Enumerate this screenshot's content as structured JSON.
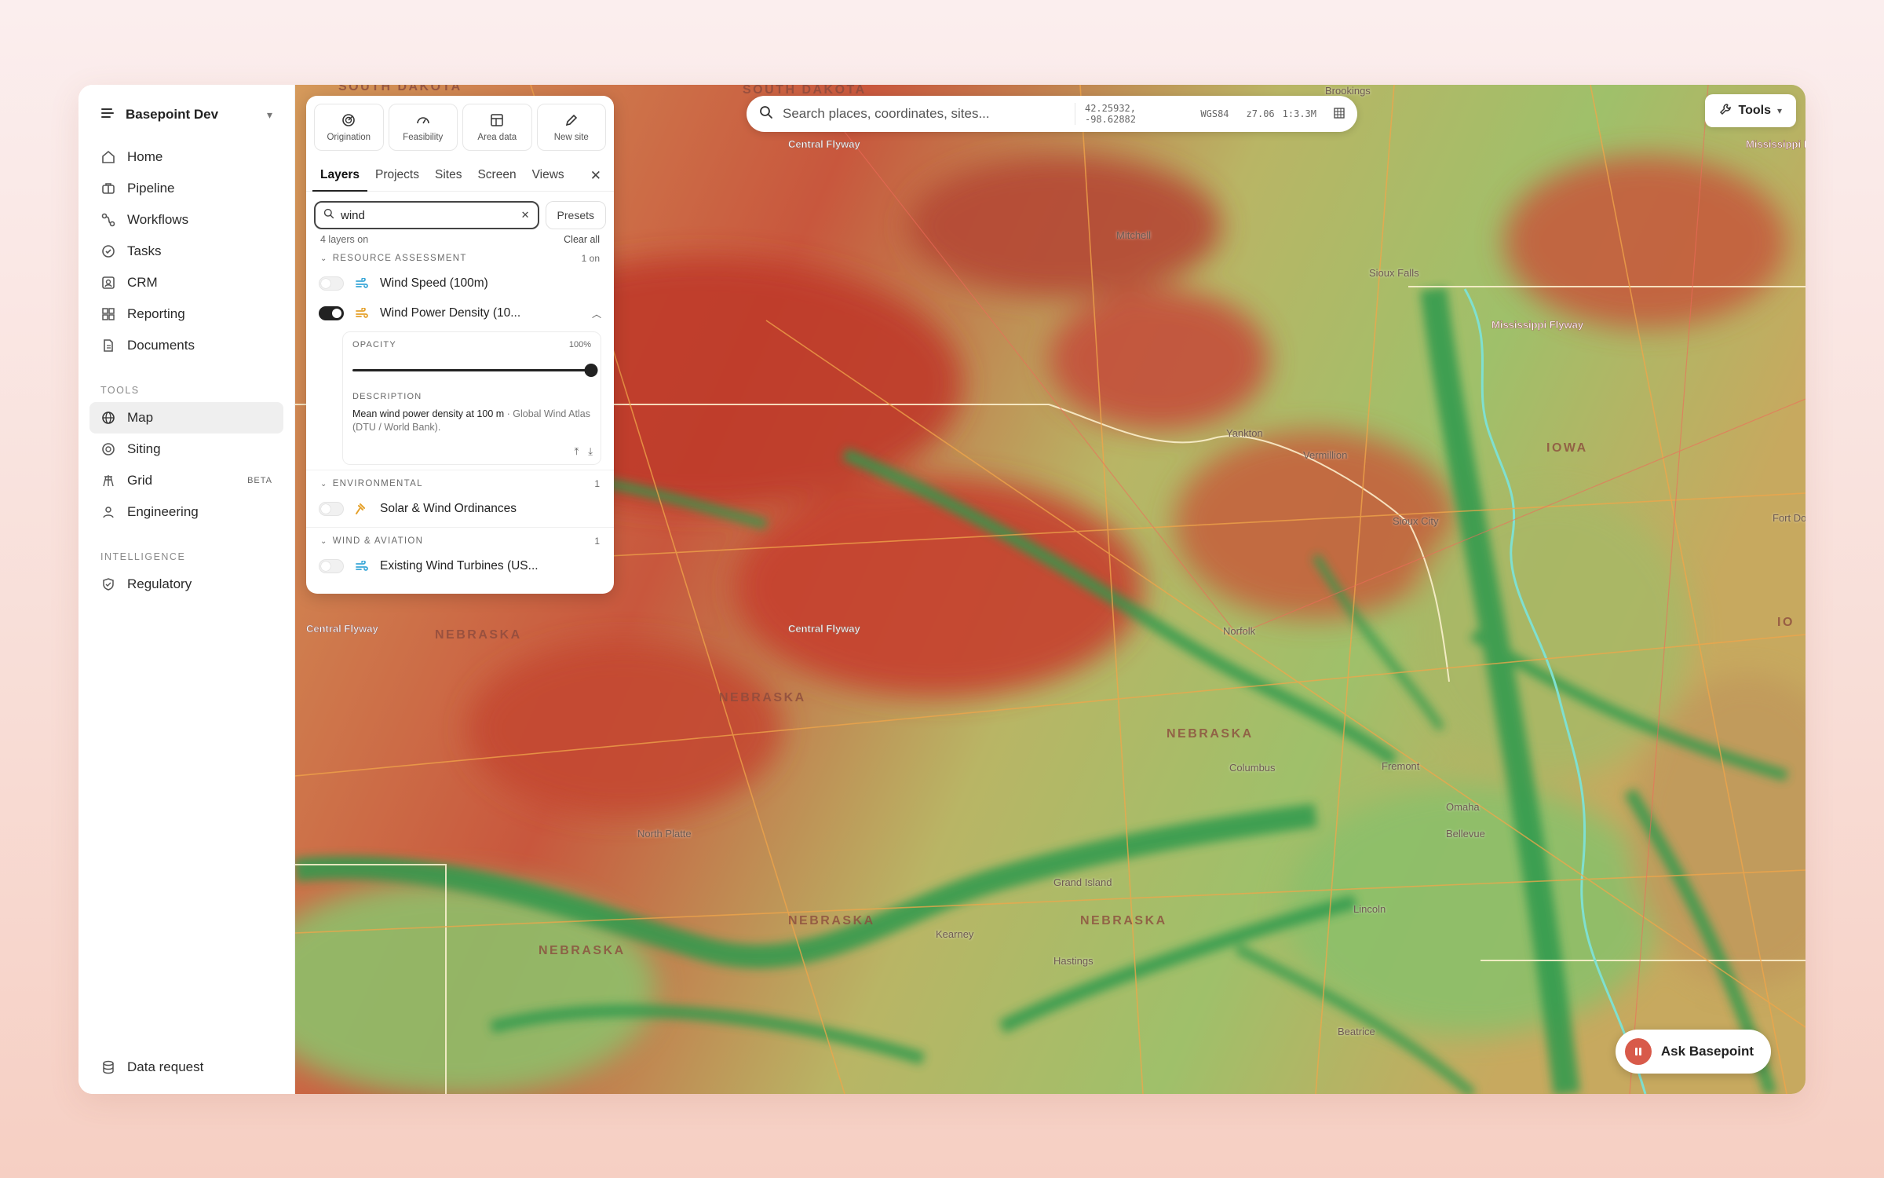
{
  "workspace": {
    "name": "Basepoint Dev"
  },
  "nav": {
    "main": [
      {
        "label": "Home",
        "icon": "home-icon"
      },
      {
        "label": "Pipeline",
        "icon": "briefcase-icon"
      },
      {
        "label": "Workflows",
        "icon": "workflow-icon"
      },
      {
        "label": "Tasks",
        "icon": "check-circle-icon"
      },
      {
        "label": "CRM",
        "icon": "contact-icon"
      },
      {
        "label": "Reporting",
        "icon": "grid-icon"
      },
      {
        "label": "Documents",
        "icon": "document-icon"
      }
    ],
    "tools_label": "TOOLS",
    "tools": [
      {
        "label": "Map",
        "icon": "globe-icon",
        "active": true
      },
      {
        "label": "Siting",
        "icon": "target-icon"
      },
      {
        "label": "Grid",
        "icon": "tower-icon",
        "badge": "BETA"
      },
      {
        "label": "Engineering",
        "icon": "engineer-icon"
      }
    ],
    "intelligence_label": "INTELLIGENCE",
    "intelligence": [
      {
        "label": "Regulatory",
        "icon": "shield-icon"
      }
    ],
    "bottom": {
      "label": "Data request",
      "icon": "database-icon"
    }
  },
  "search": {
    "placeholder": "Search places, coordinates, sites...",
    "coords": "42.25932, -98.62882",
    "datum": "WGS84",
    "zoom": "z7.06",
    "scale": "1:3.3M"
  },
  "tools_button": {
    "label": "Tools"
  },
  "ask_button": {
    "label": "Ask Basepoint"
  },
  "panel": {
    "modes": [
      {
        "label": "Origination",
        "icon": "origination-icon"
      },
      {
        "label": "Feasibility",
        "icon": "gauge-icon"
      },
      {
        "label": "Area data",
        "icon": "table-icon"
      },
      {
        "label": "New site",
        "icon": "pencil-icon"
      }
    ],
    "tabs": [
      "Layers",
      "Projects",
      "Sites",
      "Screen",
      "Views"
    ],
    "active_tab": "Layers",
    "filter_value": "wind",
    "presets_label": "Presets",
    "layers_on": "4 layers on",
    "clear_all": "Clear all",
    "groups": [
      {
        "name": "RESOURCE ASSESSMENT",
        "count": "1 on",
        "layers": [
          {
            "name": "Wind Speed (100m)",
            "on": false,
            "icon": "wind-icon"
          },
          {
            "name": "Wind Power Density (10...",
            "on": true,
            "icon": "wind-icon",
            "expanded": true,
            "opacity_label": "OPACITY",
            "opacity_value": "100%",
            "opacity": 1.0,
            "description_label": "DESCRIPTION",
            "description": "Mean wind power density at 100 m",
            "description_source": " · Global Wind Atlas (DTU / World Bank)."
          }
        ]
      },
      {
        "name": "ENVIRONMENTAL",
        "count": "1",
        "layers": [
          {
            "name": "Solar & Wind Ordinances",
            "on": false,
            "icon": "gavel-icon"
          }
        ]
      },
      {
        "name": "WIND & AVIATION",
        "count": "1",
        "layers": [
          {
            "name": "Existing Wind Turbines (US...",
            "on": false,
            "icon": "wind-icon"
          }
        ]
      }
    ]
  },
  "map": {
    "states": [
      "SOUTH DAKOTA",
      "SOUTH DAKOTA",
      "IOWA",
      "NEBRASKA",
      "NEBRASKA",
      "NEBRASKA",
      "NEBRASKA",
      "NEBRASKA",
      "NEBRASKA",
      "IO"
    ],
    "flyways": [
      "Central Flyway",
      "Central Flyway",
      "Central Flyway",
      "Mississippi Flyway",
      "Mississippi F"
    ],
    "cities": [
      "Brookings",
      "Mitchell",
      "Sioux Falls",
      "Yankton",
      "Vermillion",
      "Sioux City",
      "Norfolk",
      "Columbus",
      "Fremont",
      "Omaha",
      "Bellevue",
      "North Platte",
      "Grand Island",
      "Kearney",
      "Hastings",
      "Lincoln",
      "Beatrice",
      "Fort Do"
    ],
    "colors": {
      "high": "#c0412f",
      "mid": "#d4b36a",
      "low": "#3aa35a"
    }
  }
}
